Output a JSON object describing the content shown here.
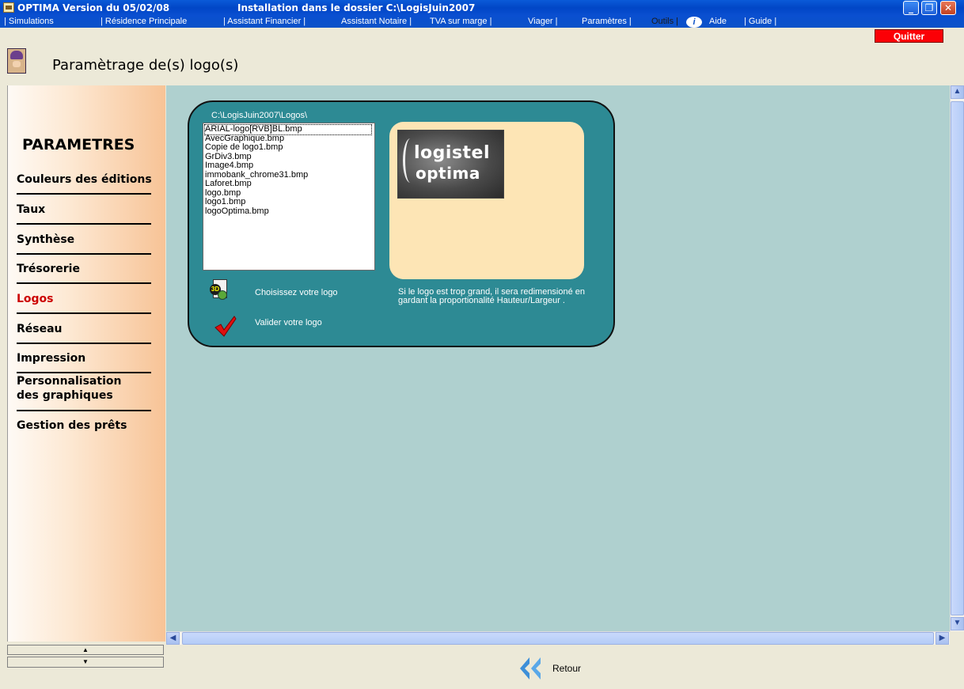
{
  "window": {
    "title_left": "OPTIMA Version du 05/02/08",
    "title_right": "Installation dans le dossier C:\\LogisJuin2007",
    "min_glyph": "_",
    "max_glyph": "❐",
    "close_glyph": "✕"
  },
  "menu": {
    "simulations": "| Simulations",
    "residence": "| Résidence Principale",
    "assistant_financier": "| Assistant Financier |",
    "assistant_notaire": "Assistant Notaire |",
    "tva": "TVA sur marge |",
    "viager": "Viager |",
    "parametres": "Paramètres |",
    "outils": "Outils |",
    "aide": "Aide",
    "guide": "| Guide |",
    "quit": "Quitter"
  },
  "header": {
    "title": "Paramètrage de(s) logo(s)"
  },
  "sidebar": {
    "heading": "PARAMETRES",
    "items": [
      {
        "label": "Couleurs des éditions"
      },
      {
        "label": "Taux"
      },
      {
        "label": "Synthèse"
      },
      {
        "label": "Trésorerie"
      },
      {
        "label": "Logos"
      },
      {
        "label": "Réseau"
      },
      {
        "label": "Impression"
      },
      {
        "label": "Personnalisation"
      },
      {
        "label": "des graphiques"
      },
      {
        "label": "Gestion des prêts"
      }
    ],
    "scroll_up": "▲",
    "scroll_down": "▼"
  },
  "logo_panel": {
    "folder": "C:\\LogisJuin2007\\Logos\\",
    "files": [
      "ARIAL-logo[RVB]BL.bmp",
      "AvecGraphique.bmp",
      "Copie de logo1.bmp",
      "GrDiv3.bmp",
      "Image4.bmp",
      "immobank_chrome31.bmp",
      "Laforet.bmp",
      "logo.bmp",
      "logo1.bmp",
      "logoOptima.bmp"
    ],
    "selected_index": 0,
    "preview_text_1": "logistel",
    "preview_text_2": "optima",
    "choose_label": "Choisissez votre logo",
    "validate_label": "Valider votre logo",
    "note": "Si le logo est trop grand, il sera redimensioné en gardant la proportionalité Hauteur/Largeur ."
  },
  "footer": {
    "back_label": "Retour"
  },
  "colors": {
    "title_bar": "#0146c6",
    "panel": "#2d8a94",
    "preview_bg": "#fde5b5",
    "workspace": "#afd0cf",
    "active_item": "#cc0000",
    "quit_button": "#fb0006"
  }
}
